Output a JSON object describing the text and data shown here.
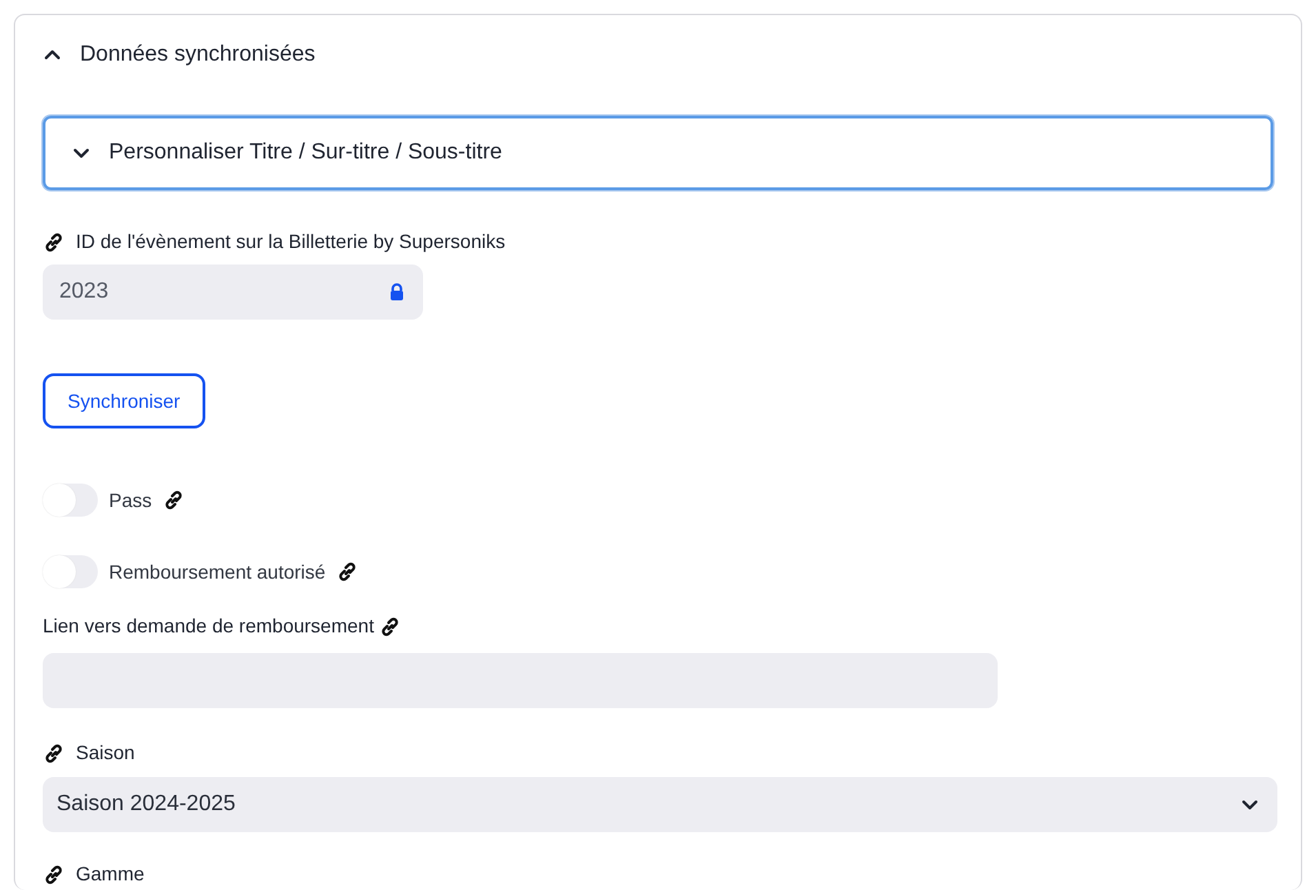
{
  "section": {
    "title": "Données synchronisées",
    "expanded": true
  },
  "subsection": {
    "title": "Personnaliser Titre / Sur-titre / Sous-titre",
    "expanded": false,
    "focused": true
  },
  "event_id": {
    "label": "ID de l'évènement sur la Billetterie by Supersoniks",
    "value": "2023",
    "locked": true
  },
  "sync_button": "Synchroniser",
  "toggles": [
    {
      "label": "Pass",
      "on": false
    },
    {
      "label": "Remboursement autorisé",
      "on": false
    }
  ],
  "refund_link": {
    "label": "Lien vers demande de remboursement"
  },
  "season": {
    "label": "Saison",
    "value": "Saison 2024-2025"
  },
  "range": {
    "label": "Gamme"
  }
}
